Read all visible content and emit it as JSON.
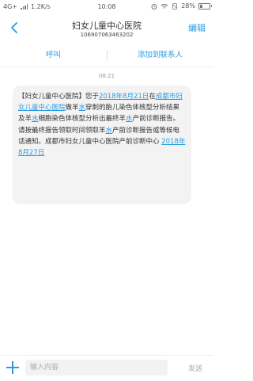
{
  "status_bar": {
    "network": "4G+",
    "speed": "1.2K/s",
    "time": "10:08",
    "battery": "28%",
    "battery_level": 0.28
  },
  "header": {
    "title": "妇女儿童中心医院",
    "subtitle": "106907063463202",
    "edit_label": "编辑"
  },
  "actions": {
    "call_label": "呼叫",
    "add_contact_label": "添加到联系人"
  },
  "message": {
    "time": "08:21",
    "parts": [
      {
        "text": "【妇女儿童中心医院】您于",
        "link": false
      },
      {
        "text": "2018年8月21日",
        "link": true
      },
      {
        "text": "在",
        "link": false
      },
      {
        "text": "成都市妇女儿童中心医院",
        "link": true
      },
      {
        "text": "做羊",
        "link": false
      },
      {
        "text": "水",
        "link": true
      },
      {
        "text": "穿刺的胎儿染色体核型分析结果及羊",
        "link": false
      },
      {
        "text": "水",
        "link": true
      },
      {
        "text": "细胞染色体核型分析出最终羊",
        "link": false
      },
      {
        "text": "水",
        "link": true
      },
      {
        "text": "产前诊断报告。请按最终报告领取时间领取羊",
        "link": false
      },
      {
        "text": "水",
        "link": true
      },
      {
        "text": "产前诊断报告或等候电话通知。成都市妇女儿童中心医院产前诊断中心 ",
        "link": false
      },
      {
        "text": "2018年8月27日",
        "link": true
      }
    ]
  },
  "composer": {
    "placeholder": "输入内容",
    "send_label": "发送"
  },
  "colors": {
    "accent": "#2b9be0",
    "bubble": "#f3f3f3"
  }
}
